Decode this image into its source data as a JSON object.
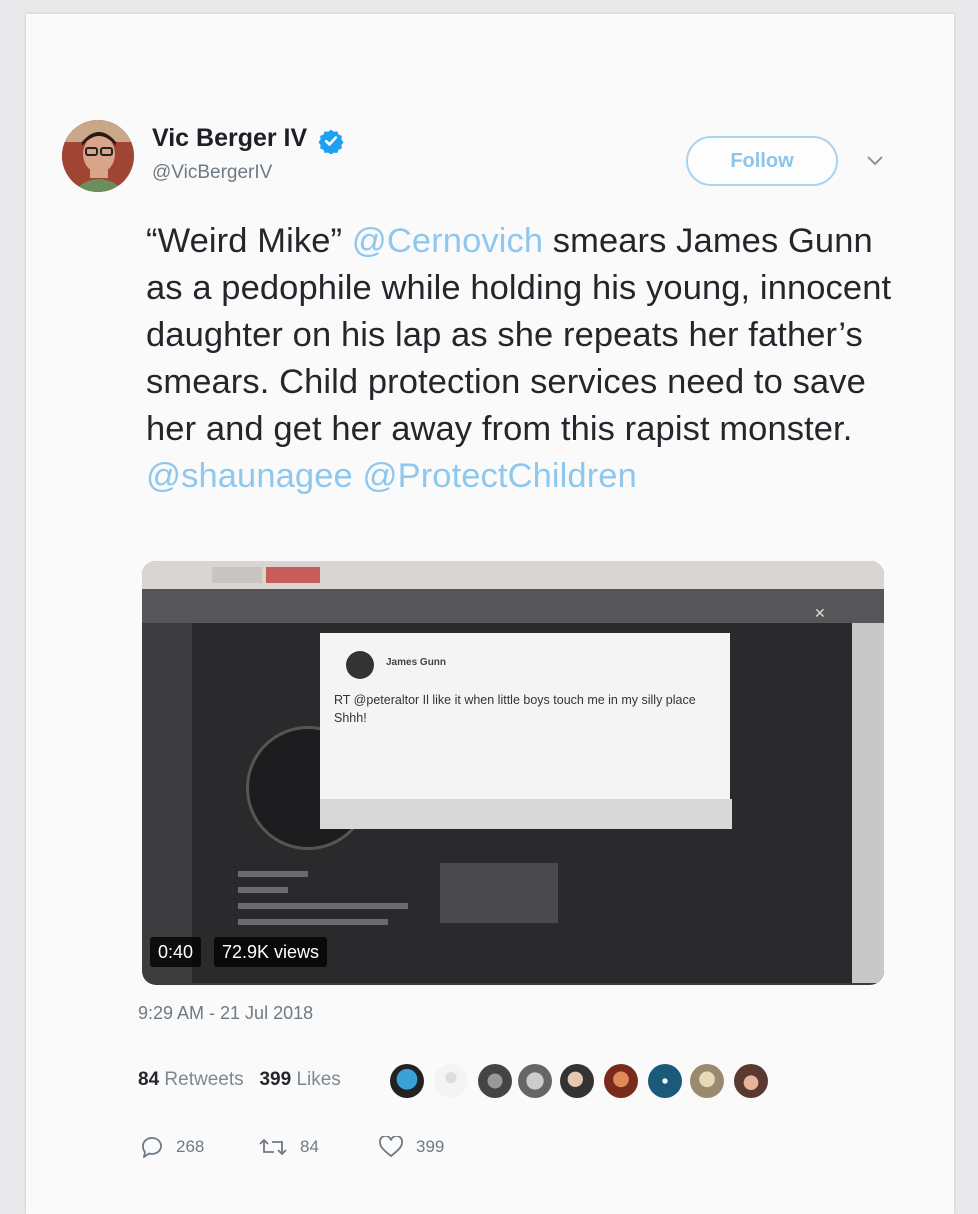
{
  "author": {
    "name": "Vic Berger IV",
    "handle": "@VicBergerIV",
    "verified": true
  },
  "follow_label": "Follow",
  "tweet": {
    "part1": "“Weird Mike” ",
    "mention1": "@Cernovich",
    "part2": " smears James Gunn as a pedophile while holding his young, innocent daughter on his lap as she repeats her father’s smears. Child protection services need to save her and get her away from this rapist monster. ",
    "mention2": "@shaunagee",
    "space": " ",
    "mention3": "@ProtectChildren"
  },
  "media": {
    "duration": "0:40",
    "views": "72.9K views",
    "inner_tweet_name": "James Gunn",
    "inner_tweet_text": "RT @peteraltor Il like it when little boys touch me in my silly place  Shhh!"
  },
  "timestamp": "9:29 AM - 21 Jul 2018",
  "stats": {
    "retweets_count": "84",
    "retweets_label": "Retweets",
    "likes_count": "399",
    "likes_label": "Likes"
  },
  "actions": {
    "replies": "268",
    "retweets": "84",
    "likes": "399"
  },
  "colors": {
    "accent": "#8fc8ee",
    "verified": "#1da1f2",
    "text": "#23262b",
    "muted": "#6f7a84"
  }
}
